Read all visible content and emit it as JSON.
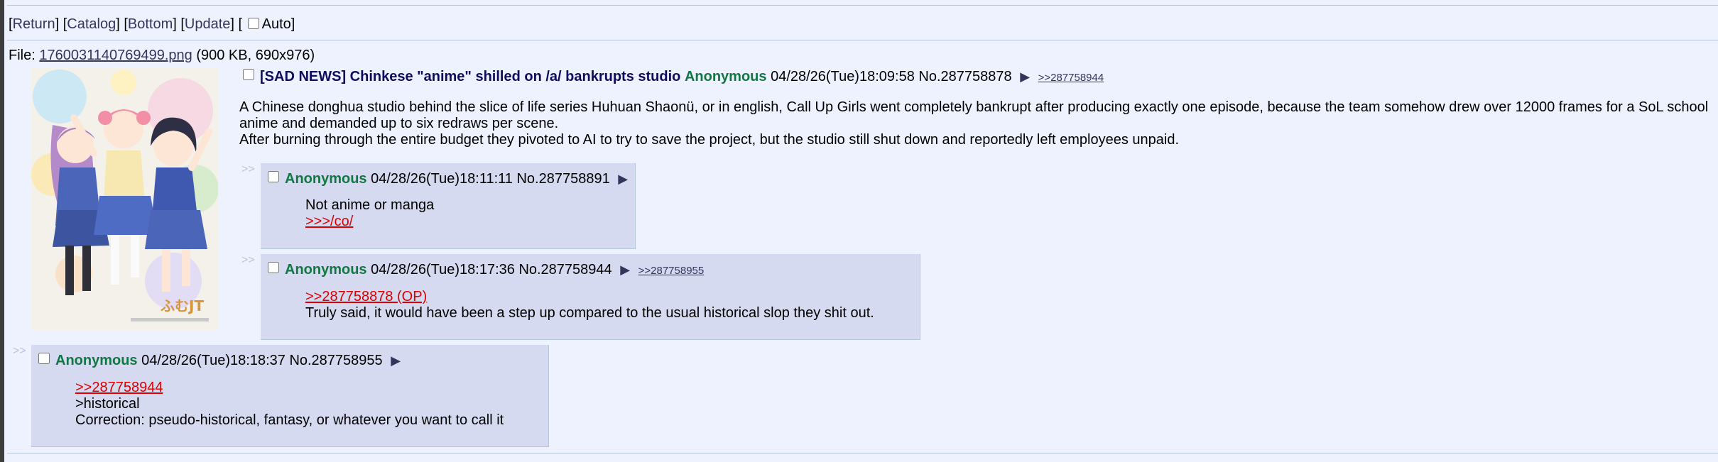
{
  "nav": {
    "return_label": "Return",
    "catalog_label": "Catalog",
    "bottom_label": "Bottom",
    "update_label": "Update",
    "auto_label": "Auto"
  },
  "file": {
    "prefix": "File: ",
    "filename": "1760031140769499.png",
    "meta": " (900 KB, 690x976)"
  },
  "op": {
    "subject": "[SAD NEWS] Chinkese \"anime\" shilled on /a/ bankrupts studio",
    "name": "Anonymous",
    "datetime": "04/28/26(Tue)18:09:58",
    "post_no": "No.287758878",
    "backlinks": [
      ">>287758944"
    ],
    "body_lines": [
      "A Chinese donghua studio behind the slice of life series Huhuan Shaonü, or in english, Call Up Girls went completely bankrupt after producing exactly one episode, because the team somehow drew over 12000 frames for a SoL school",
      "anime and demanded up to six redraws per scene.",
      "After burning through the entire budget they pivoted to AI to try to save the project, but the studio still shut down and reportedly left employees unpaid."
    ]
  },
  "replies": [
    {
      "name": "Anonymous",
      "datetime": "04/28/26(Tue)18:11:11",
      "post_no": "No.287758891",
      "backlink": "",
      "quote": "",
      "lines": [
        "Not anime or manga"
      ],
      "link_line": ">>>/co/"
    },
    {
      "name": "Anonymous",
      "datetime": "04/28/26(Tue)18:17:36",
      "post_no": "No.287758944",
      "backlink": ">>287758955",
      "quote": ">>287758878 (OP)",
      "lines": [
        "Truly said, it would have been a step up compared to the usual historical slop they shit out."
      ],
      "link_line": ""
    },
    {
      "name": "Anonymous",
      "datetime": "04/28/26(Tue)18:18:37",
      "post_no": "No.287758955",
      "backlink": "",
      "quote": ">>287758944",
      "lines": [
        ">historical",
        "Correction: pseudo-historical, fantasy, or whatever you want to call it"
      ],
      "link_line": ""
    }
  ],
  "side_arrow": ">>",
  "menu_glyph": "▶",
  "thumb_logo": "ふむJT",
  "colors": {
    "background": "#eef2ff",
    "reply_background": "#d6daf0",
    "name": "#117743",
    "subject": "#0f0c5d",
    "quotelink": "#dd0000",
    "link": "#34345c"
  }
}
